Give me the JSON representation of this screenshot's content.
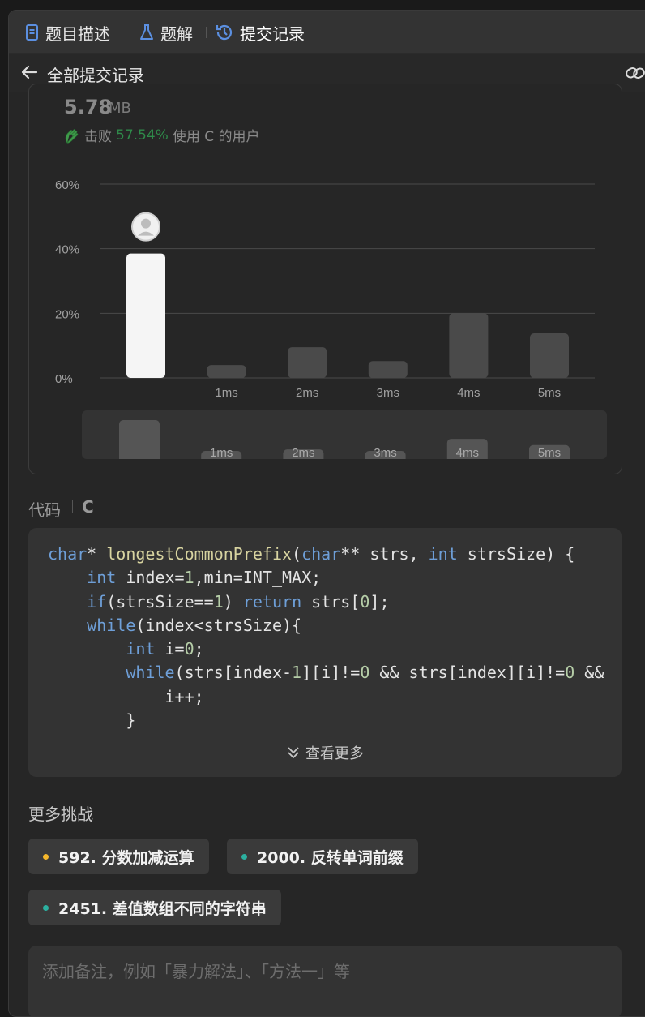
{
  "tabs": [
    {
      "label": "题目描述",
      "icon": "document-icon"
    },
    {
      "label": "题解",
      "icon": "flask-icon"
    },
    {
      "label": "提交记录",
      "icon": "history-icon"
    }
  ],
  "subbar": {
    "title": "全部提交记录"
  },
  "memory": {
    "value": "5.78",
    "unit": "MB",
    "beat_prefix": "击败",
    "beat_percent": "57.54%",
    "beat_suffix": "使用 C 的用户"
  },
  "colors": {
    "accent": "#6e9fd8",
    "beat": "#2f8a4a",
    "easy": "#2cb0a0",
    "medium": "#f5b72b"
  },
  "chart_data": {
    "type": "bar",
    "categories": [
      "",
      "1ms",
      "2ms",
      "3ms",
      "4ms",
      "5ms"
    ],
    "values": [
      38.5,
      4,
      9.5,
      5.2,
      20,
      13.8
    ],
    "highlight_index": 0,
    "yticks": [
      "60%",
      "40%",
      "20%",
      "0%"
    ],
    "ylim": [
      0,
      60
    ],
    "grid": true,
    "mini_values": [
      38.5,
      4,
      9.5,
      5.2,
      20,
      13.8
    ]
  },
  "code_section": {
    "label": "代码",
    "language": "C",
    "lines": [
      [
        {
          "t": "char",
          "c": "kw"
        },
        {
          "t": "* ",
          "c": ""
        },
        {
          "t": "longestCommonPrefix",
          "c": "fn"
        },
        {
          "t": "(",
          "c": ""
        },
        {
          "t": "char",
          "c": "kw"
        },
        {
          "t": "** strs, ",
          "c": ""
        },
        {
          "t": "int",
          "c": "kw"
        },
        {
          "t": " strsSize) {",
          "c": ""
        }
      ],
      [
        {
          "t": "    ",
          "c": ""
        },
        {
          "t": "int",
          "c": "kw"
        },
        {
          "t": " index=",
          "c": ""
        },
        {
          "t": "1",
          "c": "num"
        },
        {
          "t": ",min=INT_MAX;",
          "c": ""
        }
      ],
      [
        {
          "t": "    ",
          "c": ""
        },
        {
          "t": "if",
          "c": "kw"
        },
        {
          "t": "(strsSize==",
          "c": ""
        },
        {
          "t": "1",
          "c": "num"
        },
        {
          "t": ") ",
          "c": ""
        },
        {
          "t": "return",
          "c": "kw"
        },
        {
          "t": " strs[",
          "c": ""
        },
        {
          "t": "0",
          "c": "num"
        },
        {
          "t": "];",
          "c": ""
        }
      ],
      [
        {
          "t": "    ",
          "c": ""
        },
        {
          "t": "while",
          "c": "kw"
        },
        {
          "t": "(index<strsSize){",
          "c": ""
        }
      ],
      [
        {
          "t": "        ",
          "c": ""
        },
        {
          "t": "int",
          "c": "kw"
        },
        {
          "t": " i=",
          "c": ""
        },
        {
          "t": "0",
          "c": "num"
        },
        {
          "t": ";",
          "c": ""
        }
      ],
      [
        {
          "t": "        ",
          "c": ""
        },
        {
          "t": "while",
          "c": "kw"
        },
        {
          "t": "(strs[index-",
          "c": ""
        },
        {
          "t": "1",
          "c": "num"
        },
        {
          "t": "][i]!=",
          "c": ""
        },
        {
          "t": "0",
          "c": "num"
        },
        {
          "t": " && strs[index][i]!=",
          "c": ""
        },
        {
          "t": "0",
          "c": "num"
        },
        {
          "t": " && s",
          "c": ""
        }
      ],
      [
        {
          "t": "            i++;",
          "c": ""
        }
      ],
      [
        {
          "t": "        }",
          "c": ""
        }
      ]
    ],
    "show_more": "查看更多"
  },
  "more_challenges": {
    "title": "更多挑战",
    "items": [
      {
        "label": "592. 分数加减运算",
        "difficulty_color": "#f5b72b"
      },
      {
        "label": "2000. 反转单词前缀",
        "difficulty_color": "#2cb0a0"
      },
      {
        "label": "2451. 差值数组不同的字符串",
        "difficulty_color": "#2cb0a0"
      }
    ]
  },
  "note": {
    "placeholder": "添加备注，例如「暴力解法」、「方法一」等"
  }
}
